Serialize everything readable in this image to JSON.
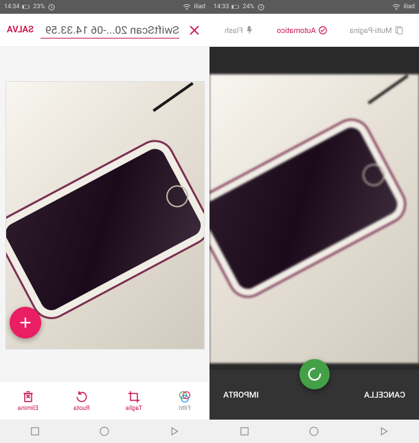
{
  "left": {
    "status": {
      "carrier": "iliad",
      "time": "14:34",
      "battery": "23%",
      "wifi": true
    },
    "header": {
      "close_icon": "close",
      "title_value": "SwiftScan 20...-06 14.33.59",
      "save_label": "SALVA"
    },
    "fab": {
      "icon": "plus"
    },
    "toolbar": [
      {
        "name": "delete",
        "label": "Elimina",
        "icon": "trash"
      },
      {
        "name": "rotate",
        "label": "Ruota",
        "icon": "rotate"
      },
      {
        "name": "crop",
        "label": "Taglia",
        "icon": "crop"
      },
      {
        "name": "filter",
        "label": "Filtri",
        "icon": "filter"
      }
    ]
  },
  "right": {
    "status": {
      "carrier": "iliad",
      "time": "14:33",
      "battery": "24%",
      "wifi": true
    },
    "modes": {
      "flash": {
        "label": "Flash",
        "active": false
      },
      "auto": {
        "label": "Automatico",
        "active": true
      },
      "multipage": {
        "label": "Multi-Pagina",
        "active": false
      }
    },
    "actions": {
      "import_label": "IMPORTA",
      "cancel_label": "CANCELLA",
      "capture_icon": "spinner"
    }
  },
  "colors": {
    "accent": "#c9124a",
    "fab": "#e91e63",
    "capture": "#43a047"
  },
  "nav": {
    "buttons": [
      "recent",
      "home",
      "back"
    ]
  }
}
